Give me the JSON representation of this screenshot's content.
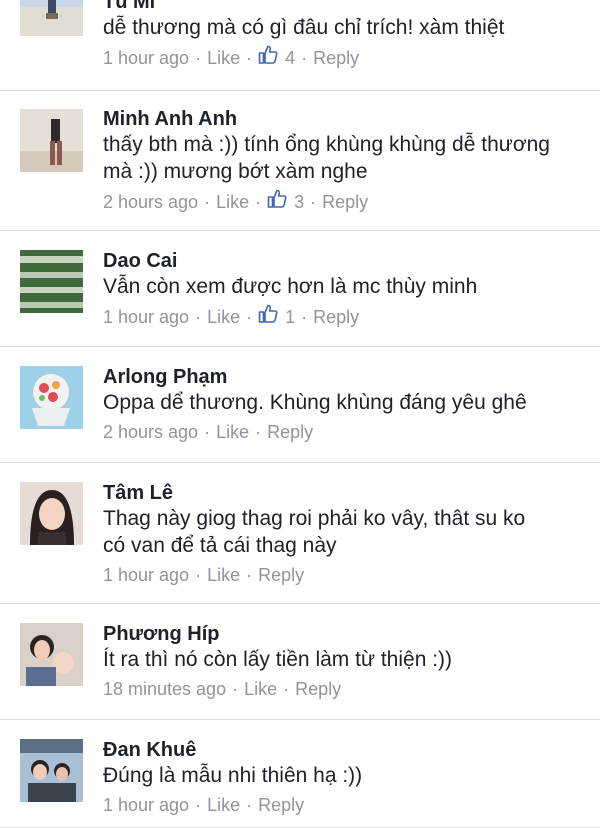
{
  "comments": [
    {
      "name": "Tú Mi",
      "text": "dễ thương mà có gì đâu chỉ trích! xàm thiệt",
      "time": "1 hour ago",
      "like": "Like",
      "likes": "4",
      "reply": "Reply"
    },
    {
      "name": "Minh Anh Anh",
      "text": "thấy bth mà :)) tính ổng khùng khùng dễ thương\nmà :)) mương bớt xàm nghe",
      "time": "2 hours ago",
      "like": "Like",
      "likes": "3",
      "reply": "Reply"
    },
    {
      "name": "Dao Cai",
      "text": "Vẫn còn xem được hơn là mc thùy minh",
      "time": "1 hour ago",
      "like": "Like",
      "likes": "1",
      "reply": "Reply"
    },
    {
      "name": "Arlong Phạm",
      "text": "Oppa dể thương.  Khùng khùng đáng yêu ghê",
      "time": "2 hours ago",
      "like": "Like",
      "reply": "Reply"
    },
    {
      "name": "Tâm Lê",
      "text": "Thag này giog thag roi phải ko vây, thât su ko\ncó van để tả cái thag này",
      "time": "1 hour ago",
      "like": "Like",
      "reply": "Reply"
    },
    {
      "name": "Phương Híp",
      "text": "Ít ra thì nó còn lấy tiền làm từ thiện :))",
      "time": "18 minutes ago",
      "like": "Like",
      "reply": "Reply"
    },
    {
      "name": "Đan Khuê",
      "text": "Đúng là mẫu nhi thiên hạ :))",
      "time": "1 hour ago",
      "like": "Like",
      "reply": "Reply"
    }
  ],
  "colors": {
    "text": "#1d2129",
    "meta": "#90949c",
    "divider": "#dcdee3",
    "thumb": "#4267b2"
  },
  "icons": {
    "like": "thumbs-up-icon"
  }
}
